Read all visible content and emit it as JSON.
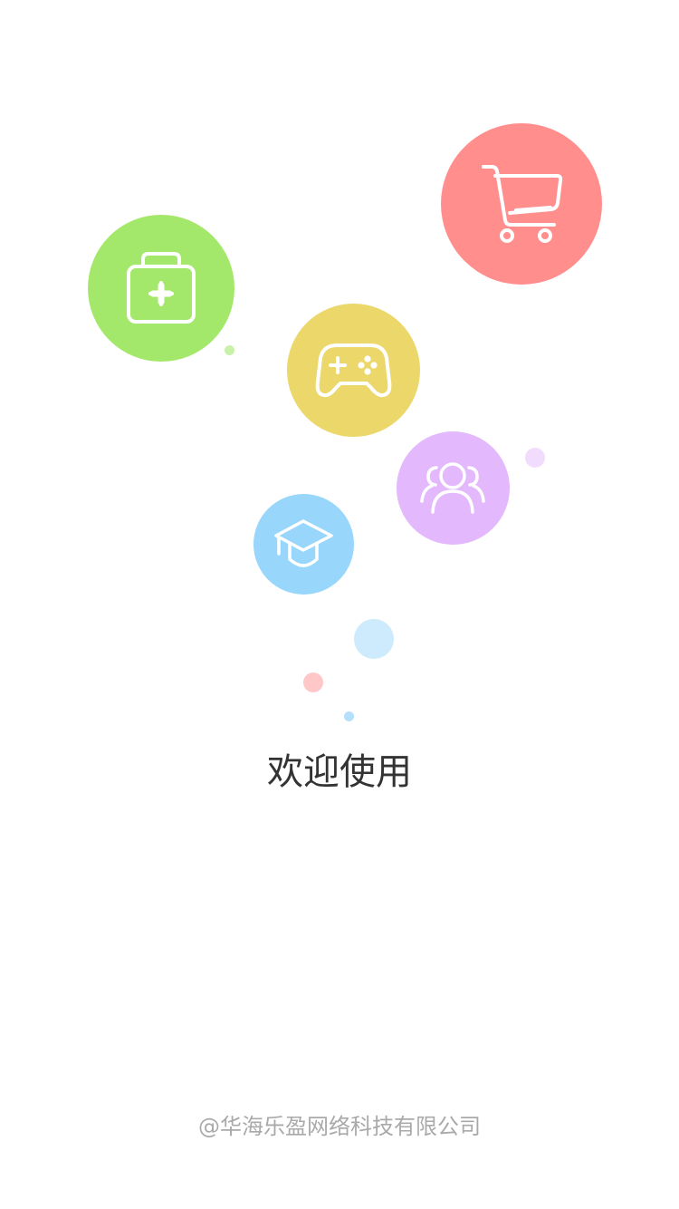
{
  "splash": {
    "welcome_text": "欢迎使用",
    "copyright": "@华海乐盈网络科技有限公司"
  },
  "icons": {
    "shopping": {
      "name": "shopping-cart-icon",
      "color": "#ff8e8d"
    },
    "medical": {
      "name": "first-aid-kit-icon",
      "color": "#a4e86b"
    },
    "games": {
      "name": "gamepad-icon",
      "color": "#ecd76a"
    },
    "social": {
      "name": "users-group-icon",
      "color": "#e3b8fc"
    },
    "education": {
      "name": "graduation-cap-icon",
      "color": "#99d6fb"
    }
  },
  "colors": {
    "background": "#ffffff",
    "welcome_text": "#333333",
    "copyright_text": "#a9a9a9",
    "icon_stroke": "#ffffff"
  }
}
